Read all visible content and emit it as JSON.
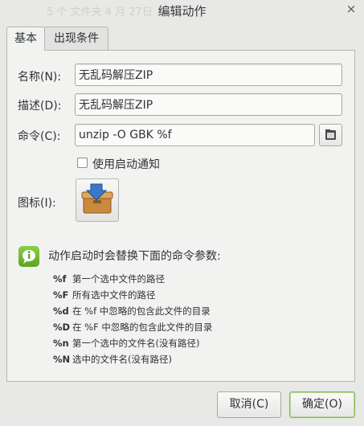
{
  "window": {
    "background_title": "5 个 文件夹    4 月 27日",
    "title": "编辑动作",
    "close_glyph": "×"
  },
  "tabs": [
    {
      "label": "基本",
      "active": true
    },
    {
      "label": "出现条件",
      "active": false
    }
  ],
  "form": {
    "name_label": "名称(N):",
    "name_value": "无乱码解压ZIP",
    "desc_label": "描述(D):",
    "desc_value": "无乱码解压ZIP",
    "cmd_label": "命令(C):",
    "cmd_value": "unzip -O GBK %f",
    "notify_label": "使用启动通知",
    "notify_checked": false,
    "icon_label": "图标(I):"
  },
  "hint": {
    "title": "动作启动时会替换下面的命令参数:",
    "rows": [
      {
        "code": "%f",
        "desc": "第一个选中文件的路径"
      },
      {
        "code": "%F",
        "desc": "所有选中文件的路径"
      },
      {
        "code": "%d",
        "desc": "在 %f 中忽略的包含此文件的目录"
      },
      {
        "code": "%D",
        "desc": "在 %F 中忽略的包含此文件的目录"
      },
      {
        "code": "%n",
        "desc": "第一个选中的文件名(没有路径)"
      },
      {
        "code": "%N",
        "desc": "选中的文件名(没有路径)"
      }
    ]
  },
  "buttons": {
    "cancel": "取消(C)",
    "ok": "确定(O)"
  },
  "colors": {
    "accent_green": "#73c02f",
    "default_border": "#86b55a",
    "icon_blue": "#3a78c9",
    "icon_box": "#c98a3e"
  }
}
